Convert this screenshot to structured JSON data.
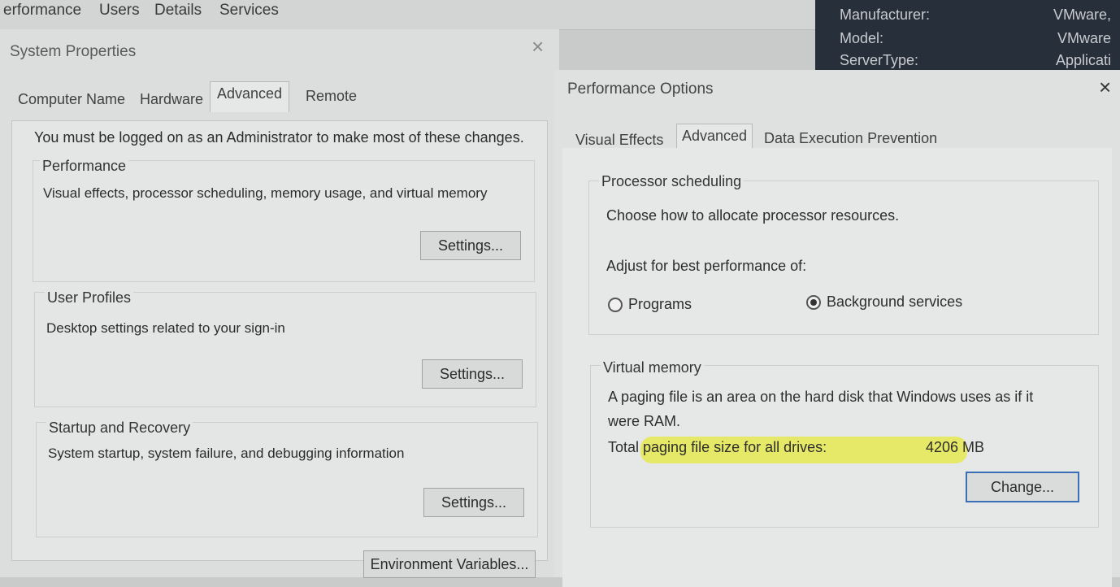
{
  "taskmanager": {
    "tabs": [
      "erformance",
      "Users",
      "Details",
      "Services"
    ],
    "info": [
      {
        "key": "Manufacturer:",
        "value": "VMware,"
      },
      {
        "key": "Model:",
        "value": "VMware"
      },
      {
        "key": "ServerType:",
        "value": "Applicati"
      }
    ]
  },
  "system_properties": {
    "title": "System Properties",
    "close": "×",
    "tabs": [
      "Computer Name",
      "Hardware",
      "Advanced",
      "Remote"
    ],
    "admin_note": "You must be logged on as an Administrator to make most of these changes.",
    "groups": [
      {
        "title": "Performance",
        "desc": "Visual effects, processor scheduling, memory usage, and virtual memory",
        "button": "Settings..."
      },
      {
        "title": "User Profiles",
        "desc": "Desktop settings related to your sign-in",
        "button": "Settings..."
      },
      {
        "title": "Startup and Recovery",
        "desc": "System startup, system failure, and debugging information",
        "button": "Settings..."
      }
    ],
    "env_button": "Environment Variables..."
  },
  "performance_options": {
    "title": "Performance Options",
    "close": "×",
    "tabs": [
      "Visual Effects",
      "Advanced",
      "Data Execution Prevention"
    ],
    "processor": {
      "title": "Processor scheduling",
      "desc": "Choose how to allocate processor resources.",
      "adjust_label": "Adjust for best performance of:",
      "options": [
        {
          "label": "Programs",
          "selected": false
        },
        {
          "label": "Background services",
          "selected": true
        }
      ]
    },
    "virtual_memory": {
      "title": "Virtual memory",
      "desc_line1": "A paging file is an area on the hard disk that Windows uses as if it",
      "desc_line2": "were RAM.",
      "total_label": "Total paging file size for all drives:",
      "total_value": "4206 MB",
      "change_button": "Change..."
    },
    "highlight_color": "#e6e83c"
  }
}
